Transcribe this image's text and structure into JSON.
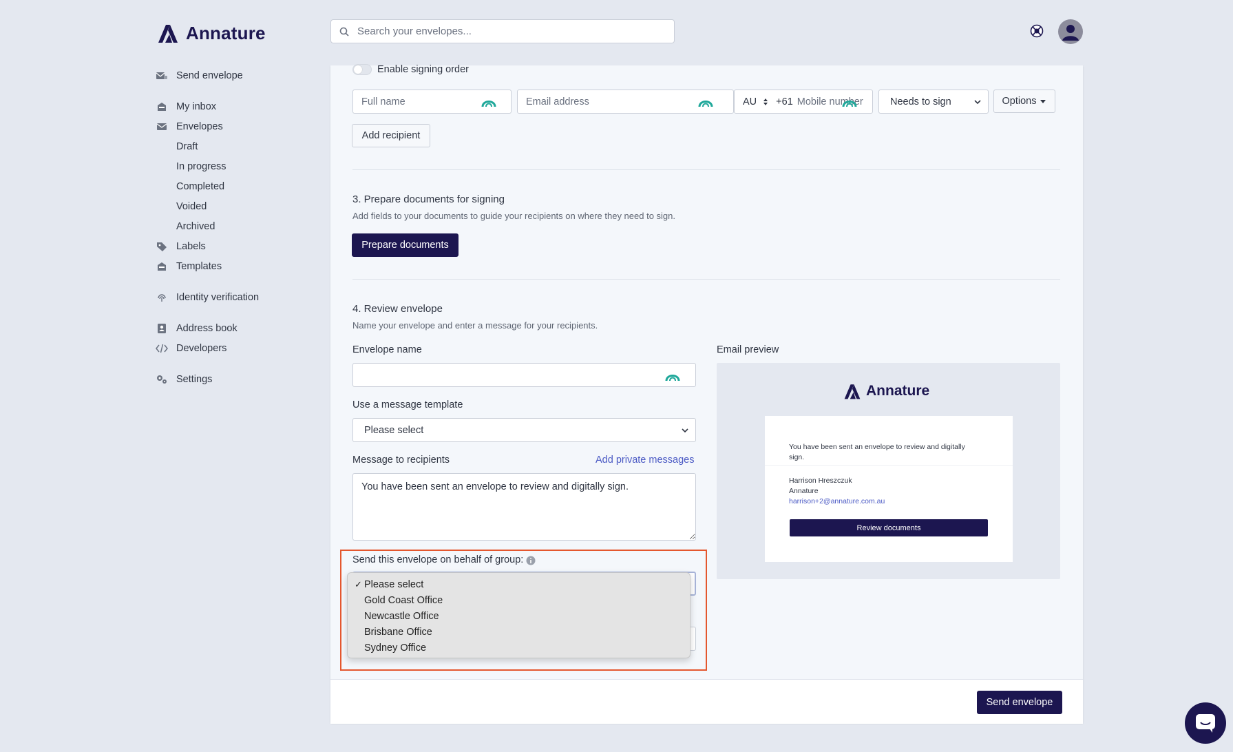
{
  "brand": {
    "name": "Annature"
  },
  "search": {
    "placeholder": "Search your envelopes..."
  },
  "sidebar": {
    "send_envelope": "Send envelope",
    "my_inbox": "My inbox",
    "envelopes": "Envelopes",
    "draft": "Draft",
    "in_progress": "In progress",
    "completed": "Completed",
    "voided": "Voided",
    "archived": "Archived",
    "labels": "Labels",
    "templates": "Templates",
    "identity_verification": "Identity verification",
    "address_book": "Address book",
    "developers": "Developers",
    "settings": "Settings"
  },
  "recipients": {
    "signing_order_label": "Enable signing order",
    "full_name_placeholder": "Full name",
    "email_placeholder": "Email address",
    "country_code": "AU",
    "dial_code": "+61",
    "mobile_placeholder": "Mobile number",
    "role_value": "Needs to sign",
    "options_label": "Options",
    "add_recipient_label": "Add recipient"
  },
  "prepare": {
    "title": "3. Prepare documents for signing",
    "description": "Add fields to your documents to guide your recipients on where they need to sign.",
    "button_label": "Prepare documents"
  },
  "review": {
    "title": "4. Review envelope",
    "description": "Name your envelope and enter a message for your recipients.",
    "envelope_name_label": "Envelope name",
    "envelope_name_value": "",
    "template_label": "Use a message template",
    "template_value": "Please select",
    "message_label": "Message to recipients",
    "private_messages_link": "Add private messages",
    "message_value": "You have been sent an envelope to review and digitally sign.",
    "group_label": "Send this envelope on behalf of group:",
    "group_options": [
      "Please select",
      "Gold Coast Office",
      "Newcastle Office",
      "Brisbane Office",
      "Sydney Office"
    ],
    "group_selected": "Please select"
  },
  "email_preview": {
    "label": "Email preview",
    "brand": "Annature",
    "message_line1": "You have been sent an envelope to review and digitally",
    "message_line2": "sign.",
    "sender_name": "Harrison Hreszczuk",
    "sender_company": "Annature",
    "sender_email": "harrison+2@annature.com.au",
    "button_label": "Review documents"
  },
  "footer": {
    "send_label": "Send envelope"
  },
  "colors": {
    "brand": "#1c1650",
    "accent": "#4a59c4",
    "highlight": "#e4572e",
    "icon_teal": "#1fa89a"
  }
}
